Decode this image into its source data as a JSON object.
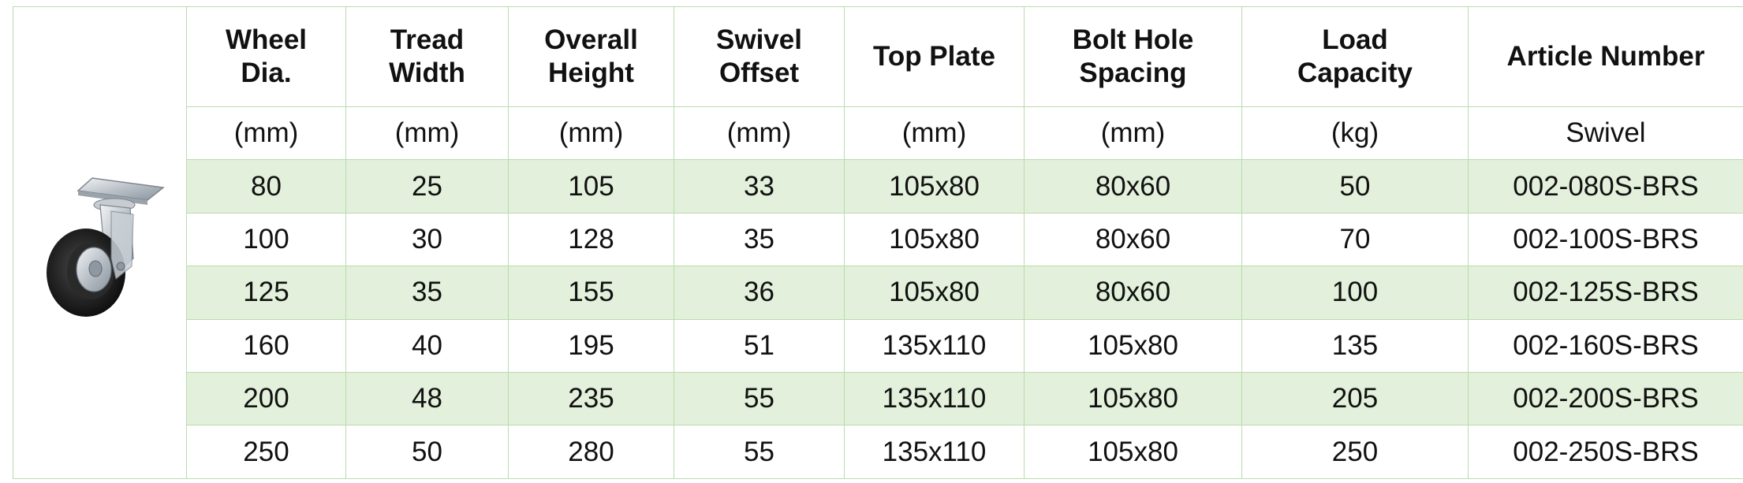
{
  "table": {
    "headers": [
      [
        "Wheel",
        "Dia."
      ],
      [
        "Tread",
        "Width"
      ],
      [
        "Overall",
        "Height"
      ],
      [
        "Swivel",
        "Offset"
      ],
      [
        "Top Plate"
      ],
      [
        "Bolt Hole",
        "Spacing"
      ],
      [
        "Load",
        "Capacity"
      ],
      [
        "Article Number"
      ]
    ],
    "units": [
      "(mm)",
      "(mm)",
      "(mm)",
      "(mm)",
      "(mm)",
      "(mm)",
      "(kg)",
      "Swivel"
    ],
    "rows": [
      [
        "80",
        "25",
        "105",
        "33",
        "105x80",
        "80x60",
        "50",
        "002-080S-BRS"
      ],
      [
        "100",
        "30",
        "128",
        "35",
        "105x80",
        "80x60",
        "70",
        "002-100S-BRS"
      ],
      [
        "125",
        "35",
        "155",
        "36",
        "105x80",
        "80x60",
        "100",
        "002-125S-BRS"
      ],
      [
        "160",
        "40",
        "195",
        "51",
        "135x110",
        "105x80",
        "135",
        "002-160S-BRS"
      ],
      [
        "200",
        "48",
        "235",
        "55",
        "135x110",
        "105x80",
        "205",
        "002-200S-BRS"
      ],
      [
        "250",
        "50",
        "280",
        "55",
        "135x110",
        "105x80",
        "250",
        "002-250S-BRS"
      ]
    ]
  },
  "product_image": {
    "icon": "swivel-caster-wheel-image"
  },
  "colors": {
    "border": "#b9dcad",
    "shaded_row": "#e3f0db"
  }
}
